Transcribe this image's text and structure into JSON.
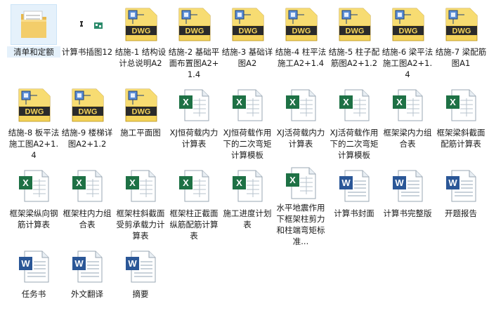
{
  "colors": {
    "selection": "#e5f1fb",
    "dwg_yellow": "#f2c230",
    "dwg_blue": "#2c5aa0",
    "excel_green": "#217346",
    "word_blue": "#2b5797"
  },
  "items": [
    {
      "label": "清单和定额",
      "icon": "folder-icon",
      "selected": true
    },
    {
      "label": "计算书插图12",
      "icon": "image-file-icon"
    },
    {
      "label": "结施-1 结构设计总说明A2",
      "icon": "dwg-file-icon"
    },
    {
      "label": "结施-2 基础平面布置图A2+1.4",
      "icon": "dwg-file-icon"
    },
    {
      "label": "结施-3 基础详图A2",
      "icon": "dwg-file-icon"
    },
    {
      "label": "结施-4 柱平法施工A2+1.4",
      "icon": "dwg-file-icon"
    },
    {
      "label": "结施-5 柱子配筋图A2+1.2",
      "icon": "dwg-file-icon"
    },
    {
      "label": "结施-6 梁平法施工图A2+1.4",
      "icon": "dwg-file-icon"
    },
    {
      "label": "结施-7 梁配筋图A1",
      "icon": "dwg-file-icon"
    },
    {
      "label": "结施-8 板平法施工图A2+1.4",
      "icon": "dwg-file-icon"
    },
    {
      "label": "结施-9 楼梯详图A2+1.2",
      "icon": "dwg-file-icon"
    },
    {
      "label": "施工平面图",
      "icon": "dwg-file-icon"
    },
    {
      "label": "XJ恒荷载内力计算表",
      "icon": "excel-file-icon"
    },
    {
      "label": "XJ恒荷载作用下的二次弯矩计算模板",
      "icon": "excel-file-icon"
    },
    {
      "label": "XJ活荷载内力计算表",
      "icon": "excel-file-icon"
    },
    {
      "label": "XJ活荷载作用下的二次弯矩计算模板",
      "icon": "excel-file-icon"
    },
    {
      "label": "框架梁内力组合表",
      "icon": "excel-file-icon"
    },
    {
      "label": "框架梁斜截面配筋计算表",
      "icon": "excel-file-icon"
    },
    {
      "label": "框架梁纵向钢筋计算表",
      "icon": "excel-file-icon"
    },
    {
      "label": "框架柱内力组合表",
      "icon": "excel-file-icon"
    },
    {
      "label": "框架柱斜截面受剪承载力计算表",
      "icon": "excel-file-icon"
    },
    {
      "label": "框架柱正截面纵筋配筋计算表",
      "icon": "excel-file-icon"
    },
    {
      "label": "施工进度计划表",
      "icon": "excel-file-icon"
    },
    {
      "label": "水平地震作用下框架柱剪力和柱端弯矩标准...",
      "icon": "excel-file-icon"
    },
    {
      "label": "计算书封面",
      "icon": "word-file-icon"
    },
    {
      "label": "计算书完整版",
      "icon": "word-file-icon"
    },
    {
      "label": "开题报告",
      "icon": "word-file-icon"
    },
    {
      "label": "任务书",
      "icon": "word-file-icon"
    },
    {
      "label": "外文翻译",
      "icon": "word-file-icon"
    },
    {
      "label": "摘要",
      "icon": "word-file-icon"
    }
  ]
}
